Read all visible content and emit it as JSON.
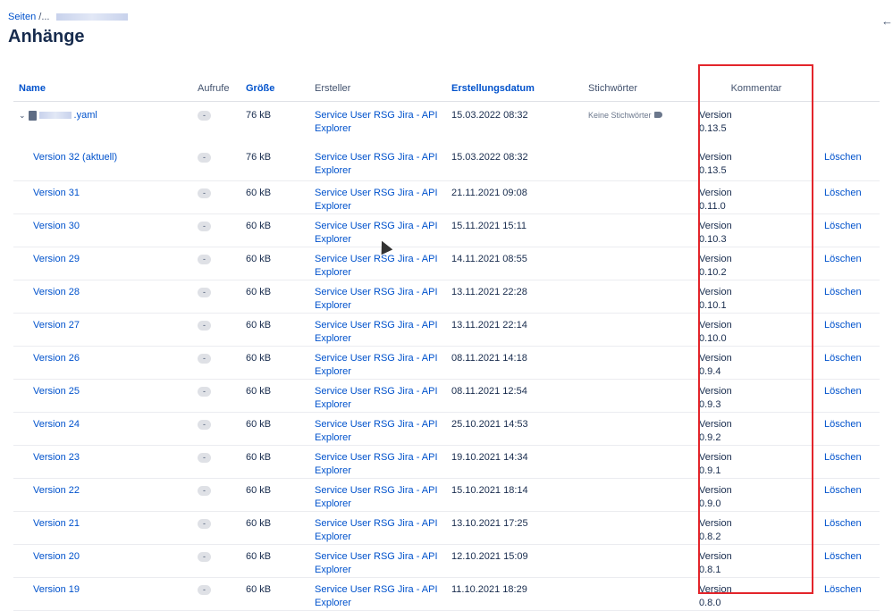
{
  "breadcrumb": {
    "root": "Seiten",
    "sep": "/...",
    "current": ""
  },
  "page": {
    "title": "Anhänge"
  },
  "icons": {
    "back": "arrow-left-icon",
    "expand": "chevron-down-icon",
    "file": "file-icon",
    "tag": "tag-icon"
  },
  "colors": {
    "link": "#0052cc",
    "highlight": "#e3252b",
    "badge": "#dfe1e6"
  },
  "table": {
    "headers": {
      "name": "Name",
      "views": "Aufrufe",
      "size": "Größe",
      "creator": "Ersteller",
      "created": "Erstellungsdatum",
      "tags": "Stichwörter",
      "comment": "Kommentar"
    },
    "parent": {
      "file_suffix": ".yaml",
      "views": "-",
      "size": "76 kB",
      "creator_line1": "Service User RSG Jira - API",
      "creator_line2": "Explorer",
      "created": "15.03.2022 08:32",
      "tags": "Keine Stichwörter",
      "comment_line1": "Version",
      "comment_line2": "0.13.5"
    },
    "rows": [
      {
        "version": "Version 32 (aktuell)",
        "views": "-",
        "size": "76 kB",
        "creator_line1": "Service User RSG Jira - API",
        "creator_line2": "Explorer",
        "created": "15.03.2022 08:32",
        "comment_line1": "Version",
        "comment_line2": "0.13.5",
        "action": "Löschen"
      },
      {
        "version": "Version 31",
        "views": "-",
        "size": "60 kB",
        "creator_line1": "Service User RSG Jira - API",
        "creator_line2": "Explorer",
        "created": "21.11.2021 09:08",
        "comment_line1": "Version",
        "comment_line2": "0.11.0",
        "action": "Löschen"
      },
      {
        "version": "Version 30",
        "views": "-",
        "size": "60 kB",
        "creator_line1": "Service User RSG Jira - API",
        "creator_line2": "Explorer",
        "created": "15.11.2021 15:11",
        "comment_line1": "Version",
        "comment_line2": "0.10.3",
        "action": "Löschen"
      },
      {
        "version": "Version 29",
        "views": "-",
        "size": "60 kB",
        "creator_line1": "Service User RSG Jira - API",
        "creator_line2": "Explorer",
        "created": "14.11.2021 08:55",
        "comment_line1": "Version",
        "comment_line2": "0.10.2",
        "action": "Löschen"
      },
      {
        "version": "Version 28",
        "views": "-",
        "size": "60 kB",
        "creator_line1": "Service User RSG Jira - API",
        "creator_line2": "Explorer",
        "created": "13.11.2021 22:28",
        "comment_line1": "Version",
        "comment_line2": "0.10.1",
        "action": "Löschen"
      },
      {
        "version": "Version 27",
        "views": "-",
        "size": "60 kB",
        "creator_line1": "Service User RSG Jira - API",
        "creator_line2": "Explorer",
        "created": "13.11.2021 22:14",
        "comment_line1": "Version",
        "comment_line2": "0.10.0",
        "action": "Löschen"
      },
      {
        "version": "Version 26",
        "views": "-",
        "size": "60 kB",
        "creator_line1": "Service User RSG Jira - API",
        "creator_line2": "Explorer",
        "created": "08.11.2021 14:18",
        "comment_line1": "Version",
        "comment_line2": "0.9.4",
        "action": "Löschen"
      },
      {
        "version": "Version 25",
        "views": "-",
        "size": "60 kB",
        "creator_line1": "Service User RSG Jira - API",
        "creator_line2": "Explorer",
        "created": "08.11.2021 12:54",
        "comment_line1": "Version",
        "comment_line2": "0.9.3",
        "action": "Löschen"
      },
      {
        "version": "Version 24",
        "views": "-",
        "size": "60 kB",
        "creator_line1": "Service User RSG Jira - API",
        "creator_line2": "Explorer",
        "created": "25.10.2021 14:53",
        "comment_line1": "Version",
        "comment_line2": "0.9.2",
        "action": "Löschen"
      },
      {
        "version": "Version 23",
        "views": "-",
        "size": "60 kB",
        "creator_line1": "Service User RSG Jira - API",
        "creator_line2": "Explorer",
        "created": "19.10.2021 14:34",
        "comment_line1": "Version",
        "comment_line2": "0.9.1",
        "action": "Löschen"
      },
      {
        "version": "Version 22",
        "views": "-",
        "size": "60 kB",
        "creator_line1": "Service User RSG Jira - API",
        "creator_line2": "Explorer",
        "created": "15.10.2021 18:14",
        "comment_line1": "Version",
        "comment_line2": "0.9.0",
        "action": "Löschen"
      },
      {
        "version": "Version 21",
        "views": "-",
        "size": "60 kB",
        "creator_line1": "Service User RSG Jira - API",
        "creator_line2": "Explorer",
        "created": "13.10.2021 17:25",
        "comment_line1": "Version",
        "comment_line2": "0.8.2",
        "action": "Löschen"
      },
      {
        "version": "Version 20",
        "views": "-",
        "size": "60 kB",
        "creator_line1": "Service User RSG Jira - API",
        "creator_line2": "Explorer",
        "created": "12.10.2021 15:09",
        "comment_line1": "Version",
        "comment_line2": "0.8.1",
        "action": "Löschen"
      },
      {
        "version": "Version 19",
        "views": "-",
        "size": "60 kB",
        "creator_line1": "Service User RSG Jira - API",
        "creator_line2": "Explorer",
        "created": "11.10.2021 18:29",
        "comment_line1": "Version",
        "comment_line2": "0.8.0",
        "action": "Löschen"
      }
    ]
  }
}
